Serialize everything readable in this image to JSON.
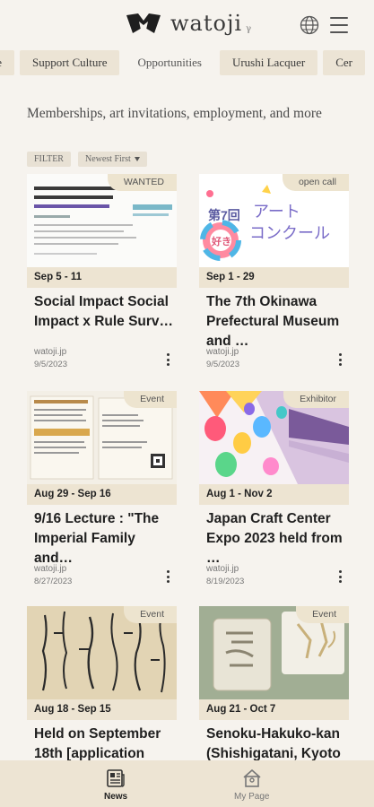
{
  "header": {
    "logo_text": "watoji",
    "logo_sub": "γ",
    "globe_icon": "globe-icon",
    "menu_icon": "hamburger-menu-icon"
  },
  "tabs": [
    {
      "label": "nce"
    },
    {
      "label": "Support Culture"
    },
    {
      "label": "Opportunities",
      "active": true
    },
    {
      "label": "Urushi Lacquer"
    },
    {
      "label": "Cer"
    }
  ],
  "intro": "Memberships, art invitations, employment, and more",
  "filter": {
    "label": "FILTER",
    "sort": "Newest First"
  },
  "cards": [
    {
      "badge": "WANTED",
      "date": "Sep 5 - 11",
      "title": "Social Impact Social Impact x Rule Surv…",
      "source": "watoji.jp",
      "posted": "9/5/2023"
    },
    {
      "badge": "open call",
      "date": "Sep 1 - 29",
      "title": "The 7th Okinawa Prefectural Museum and …",
      "source": "watoji.jp",
      "posted": "9/5/2023",
      "thumb_text_1": "第7回",
      "thumb_text_2": "アート",
      "thumb_text_3": "コンクール",
      "thumb_text_4": "好き"
    },
    {
      "badge": "Event",
      "date": "Aug 29 - Sep 16",
      "title": "9/16 Lecture : \"The Imperial Family and…",
      "source": "watoji.jp",
      "posted": "8/27/2023"
    },
    {
      "badge": "Exhibitor",
      "date": "Aug 1 - Nov 2",
      "title": "Japan Craft Center Expo 2023 held from …",
      "source": "watoji.jp",
      "posted": "8/19/2023"
    },
    {
      "badge": "Event",
      "date": "Aug 18 - Sep 15",
      "title": "Held on September 18th [application",
      "source": "",
      "posted": ""
    },
    {
      "badge": "Event",
      "date": "Aug 21 - Oct 7",
      "title": "Senoku-Hakuko-kan (Shishigatani, Kyoto",
      "source": "",
      "posted": ""
    }
  ],
  "bottom_nav": [
    {
      "label": "News",
      "icon": "newspaper-icon",
      "active": true
    },
    {
      "label": "My Page",
      "icon": "home-icon"
    }
  ],
  "colors": {
    "background": "#f6f3ee",
    "tab": "#ece4d5",
    "badge": "#ede4cf",
    "nav": "#ede4d3"
  }
}
